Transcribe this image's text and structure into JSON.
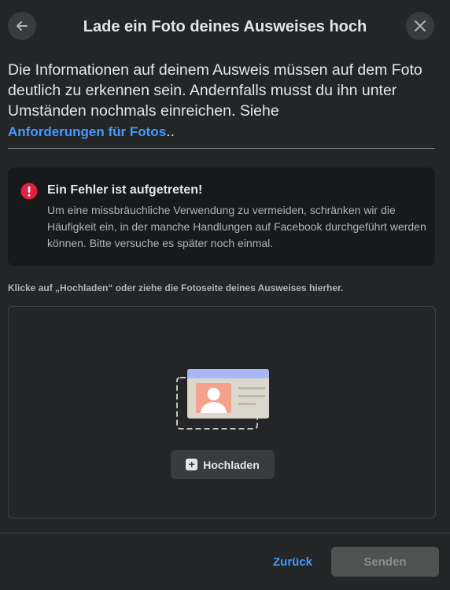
{
  "header": {
    "title": "Lade ein Foto deines Ausweises hoch"
  },
  "intro": {
    "text": "Die Informationen auf deinem Ausweis müssen auf dem Foto deutlich zu erkennen sein. Andernfalls musst du ihn unter Umständen nochmals einreichen. Siehe",
    "link_label": "Anforderungen für Fotos",
    "trailing": ".."
  },
  "error": {
    "title": "Ein Fehler ist aufgetreten!",
    "message": "Um eine missbräuchliche Verwendung zu vermeiden, schränken wir die Häufigkeit ein, in der manche Handlungen auf Facebook durchgeführt werden können. Bitte versuche es später noch einmal.",
    "color": "#e41e3f"
  },
  "upload": {
    "instruction": "Klicke auf „Hochladen“ oder ziehe die Fotoseite deines Ausweises hierher.",
    "button_label": "Hochladen"
  },
  "footer": {
    "back_label": "Zurück",
    "send_label": "Senden"
  },
  "icons": {
    "back": "arrow-left-icon",
    "close": "close-icon",
    "error": "exclamation-circle-icon",
    "upload": "plus-square-icon"
  },
  "colors": {
    "link": "#4599ff",
    "background": "#242526",
    "error_box": "#18191a"
  }
}
